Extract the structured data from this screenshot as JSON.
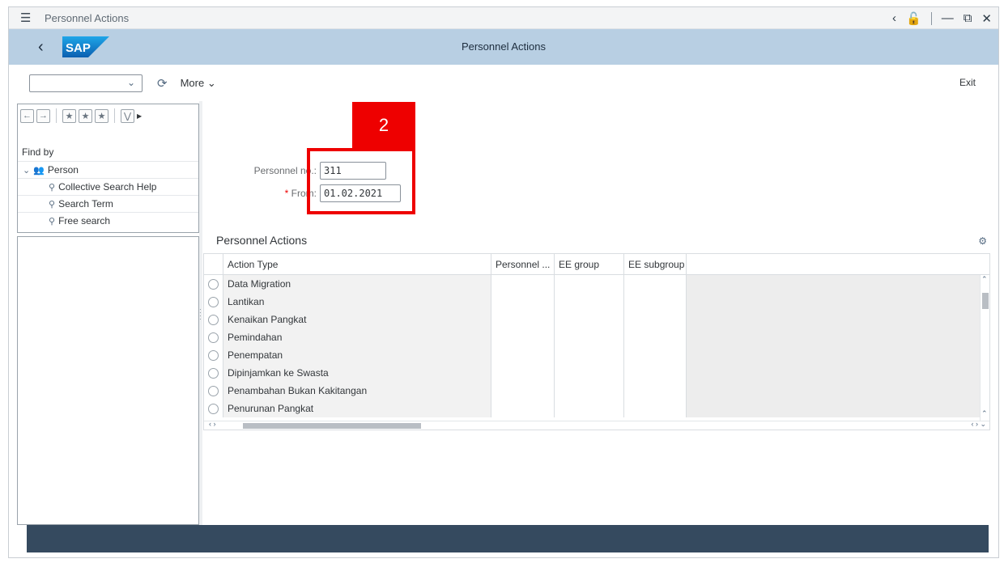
{
  "window": {
    "title": "Personnel Actions"
  },
  "shell": {
    "back_icon": "back-chevron-icon",
    "logo": "SAP",
    "title": "Personnel Actions"
  },
  "toolbar": {
    "more_label": "More",
    "exit_label": "Exit"
  },
  "navigation": {
    "find_by": "Find by",
    "root": "Person",
    "items": [
      "Collective Search Help",
      "Search Term",
      "Free search"
    ]
  },
  "form": {
    "personnel_no_label": "Personnel no.:",
    "personnel_no_value": "311",
    "from_label": "From:",
    "from_required_mark": "*",
    "from_value": "01.02.2021"
  },
  "callout": {
    "number": "2",
    "color": "#ee0000"
  },
  "actions_table": {
    "title": "Personnel Actions",
    "columns": [
      "Action Type",
      "Personnel ...",
      "EE group",
      "EE subgroup"
    ],
    "rows": [
      "Data Migration",
      "Lantikan",
      "Kenaikan Pangkat",
      "Pemindahan",
      "Penempatan",
      "Dipinjamkan ke Swasta",
      "Penambahan Bukan Kakitangan",
      "Penurunan Pangkat"
    ]
  },
  "colors": {
    "shell_bg": "#b8cfe3",
    "status_bar": "#354a5f",
    "accent_red": "#ee0000"
  }
}
